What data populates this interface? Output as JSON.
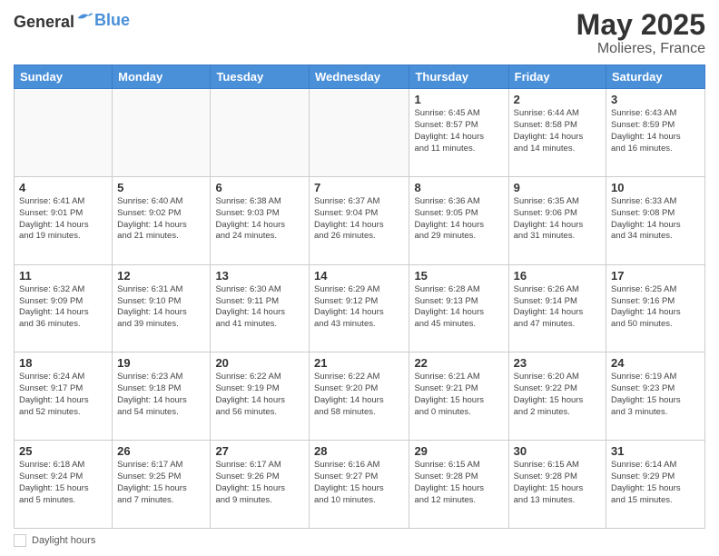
{
  "header": {
    "logo_general": "General",
    "logo_blue": "Blue",
    "month_title": "May 2025",
    "location": "Molieres, France"
  },
  "footer": {
    "daylight_label": "Daylight hours"
  },
  "days_of_week": [
    "Sunday",
    "Monday",
    "Tuesday",
    "Wednesday",
    "Thursday",
    "Friday",
    "Saturday"
  ],
  "weeks": [
    [
      {
        "day": "",
        "info": ""
      },
      {
        "day": "",
        "info": ""
      },
      {
        "day": "",
        "info": ""
      },
      {
        "day": "",
        "info": ""
      },
      {
        "day": "1",
        "info": "Sunrise: 6:45 AM\nSunset: 8:57 PM\nDaylight: 14 hours\nand 11 minutes."
      },
      {
        "day": "2",
        "info": "Sunrise: 6:44 AM\nSunset: 8:58 PM\nDaylight: 14 hours\nand 14 minutes."
      },
      {
        "day": "3",
        "info": "Sunrise: 6:43 AM\nSunset: 8:59 PM\nDaylight: 14 hours\nand 16 minutes."
      }
    ],
    [
      {
        "day": "4",
        "info": "Sunrise: 6:41 AM\nSunset: 9:01 PM\nDaylight: 14 hours\nand 19 minutes."
      },
      {
        "day": "5",
        "info": "Sunrise: 6:40 AM\nSunset: 9:02 PM\nDaylight: 14 hours\nand 21 minutes."
      },
      {
        "day": "6",
        "info": "Sunrise: 6:38 AM\nSunset: 9:03 PM\nDaylight: 14 hours\nand 24 minutes."
      },
      {
        "day": "7",
        "info": "Sunrise: 6:37 AM\nSunset: 9:04 PM\nDaylight: 14 hours\nand 26 minutes."
      },
      {
        "day": "8",
        "info": "Sunrise: 6:36 AM\nSunset: 9:05 PM\nDaylight: 14 hours\nand 29 minutes."
      },
      {
        "day": "9",
        "info": "Sunrise: 6:35 AM\nSunset: 9:06 PM\nDaylight: 14 hours\nand 31 minutes."
      },
      {
        "day": "10",
        "info": "Sunrise: 6:33 AM\nSunset: 9:08 PM\nDaylight: 14 hours\nand 34 minutes."
      }
    ],
    [
      {
        "day": "11",
        "info": "Sunrise: 6:32 AM\nSunset: 9:09 PM\nDaylight: 14 hours\nand 36 minutes."
      },
      {
        "day": "12",
        "info": "Sunrise: 6:31 AM\nSunset: 9:10 PM\nDaylight: 14 hours\nand 39 minutes."
      },
      {
        "day": "13",
        "info": "Sunrise: 6:30 AM\nSunset: 9:11 PM\nDaylight: 14 hours\nand 41 minutes."
      },
      {
        "day": "14",
        "info": "Sunrise: 6:29 AM\nSunset: 9:12 PM\nDaylight: 14 hours\nand 43 minutes."
      },
      {
        "day": "15",
        "info": "Sunrise: 6:28 AM\nSunset: 9:13 PM\nDaylight: 14 hours\nand 45 minutes."
      },
      {
        "day": "16",
        "info": "Sunrise: 6:26 AM\nSunset: 9:14 PM\nDaylight: 14 hours\nand 47 minutes."
      },
      {
        "day": "17",
        "info": "Sunrise: 6:25 AM\nSunset: 9:16 PM\nDaylight: 14 hours\nand 50 minutes."
      }
    ],
    [
      {
        "day": "18",
        "info": "Sunrise: 6:24 AM\nSunset: 9:17 PM\nDaylight: 14 hours\nand 52 minutes."
      },
      {
        "day": "19",
        "info": "Sunrise: 6:23 AM\nSunset: 9:18 PM\nDaylight: 14 hours\nand 54 minutes."
      },
      {
        "day": "20",
        "info": "Sunrise: 6:22 AM\nSunset: 9:19 PM\nDaylight: 14 hours\nand 56 minutes."
      },
      {
        "day": "21",
        "info": "Sunrise: 6:22 AM\nSunset: 9:20 PM\nDaylight: 14 hours\nand 58 minutes."
      },
      {
        "day": "22",
        "info": "Sunrise: 6:21 AM\nSunset: 9:21 PM\nDaylight: 15 hours\nand 0 minutes."
      },
      {
        "day": "23",
        "info": "Sunrise: 6:20 AM\nSunset: 9:22 PM\nDaylight: 15 hours\nand 2 minutes."
      },
      {
        "day": "24",
        "info": "Sunrise: 6:19 AM\nSunset: 9:23 PM\nDaylight: 15 hours\nand 3 minutes."
      }
    ],
    [
      {
        "day": "25",
        "info": "Sunrise: 6:18 AM\nSunset: 9:24 PM\nDaylight: 15 hours\nand 5 minutes."
      },
      {
        "day": "26",
        "info": "Sunrise: 6:17 AM\nSunset: 9:25 PM\nDaylight: 15 hours\nand 7 minutes."
      },
      {
        "day": "27",
        "info": "Sunrise: 6:17 AM\nSunset: 9:26 PM\nDaylight: 15 hours\nand 9 minutes."
      },
      {
        "day": "28",
        "info": "Sunrise: 6:16 AM\nSunset: 9:27 PM\nDaylight: 15 hours\nand 10 minutes."
      },
      {
        "day": "29",
        "info": "Sunrise: 6:15 AM\nSunset: 9:28 PM\nDaylight: 15 hours\nand 12 minutes."
      },
      {
        "day": "30",
        "info": "Sunrise: 6:15 AM\nSunset: 9:28 PM\nDaylight: 15 hours\nand 13 minutes."
      },
      {
        "day": "31",
        "info": "Sunrise: 6:14 AM\nSunset: 9:29 PM\nDaylight: 15 hours\nand 15 minutes."
      }
    ]
  ]
}
